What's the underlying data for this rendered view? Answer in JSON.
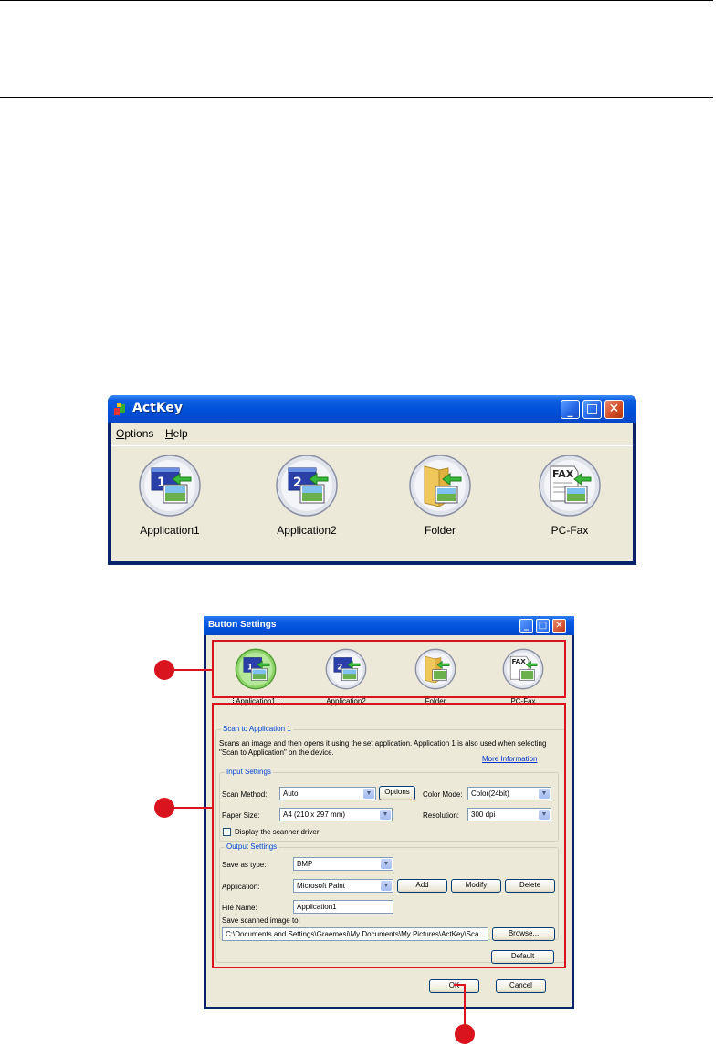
{
  "actkey": {
    "title": "ActKey",
    "menu": [
      "Options",
      "Help"
    ],
    "buttons": [
      {
        "label": "Application1",
        "icon": "application1-icon"
      },
      {
        "label": "Application2",
        "icon": "application2-icon"
      },
      {
        "label": "Folder",
        "icon": "folder-icon"
      },
      {
        "label": "PC-Fax",
        "icon": "pc-fax-icon"
      }
    ]
  },
  "button_settings": {
    "title": "Button Settings",
    "icons": [
      {
        "label": "Application1",
        "selected": true
      },
      {
        "label": "Application2"
      },
      {
        "label": "Folder"
      },
      {
        "label": "PC-Fax"
      }
    ],
    "section_title": "Scan to Application 1",
    "description": "Scans an image and then opens it using the set application. Application 1 is also used when selecting \"Scan to Application\" on the device.",
    "more_info": "More Information",
    "input_settings": {
      "title": "Input Settings",
      "scan_method_label": "Scan Method:",
      "scan_method_value": "Auto",
      "options_button": "Options",
      "color_mode_label": "Color Mode:",
      "color_mode_value": "Color(24bit)",
      "paper_size_label": "Paper Size:",
      "paper_size_value": "A4 (210 x 297 mm)",
      "resolution_label": "Resolution:",
      "resolution_value": "300 dpi",
      "display_driver_label": "Display the scanner driver"
    },
    "output_settings": {
      "title": "Output Settings",
      "save_as_label": "Save as type:",
      "save_as_value": "BMP",
      "application_label": "Application:",
      "application_value": "Microsoft Paint",
      "add_button": "Add",
      "modify_button": "Modify",
      "delete_button": "Delete",
      "file_name_label": "File Name:",
      "file_name_value": "Application1",
      "save_to_label": "Save scanned image to:",
      "save_to_value": "C:\\Documents and Settings\\Graemesi\\My Documents\\My Pictures\\ActKey\\Sca",
      "browse_button": "Browse..."
    },
    "default_button": "Default",
    "ok_button": "OK",
    "cancel_button": "Cancel"
  },
  "colors": {
    "callout": "#d9141e",
    "xp_title": "#0050d8",
    "window_bg": "#ece9d8"
  }
}
